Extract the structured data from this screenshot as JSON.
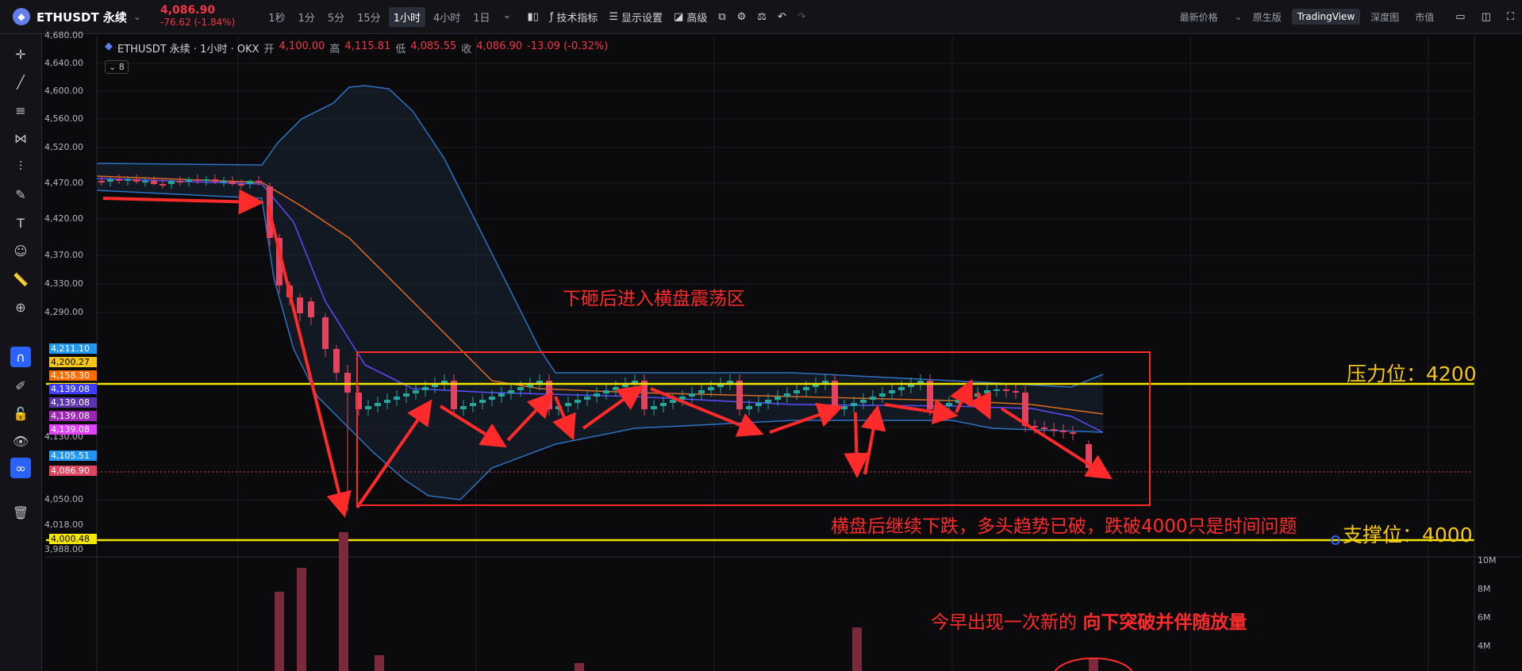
{
  "topbar": {
    "coin_icon": "eth-icon",
    "symbol": "ETHUSDT 永续",
    "last_price": "4,086.90",
    "change": "-76.62 (-1.84%)",
    "timeframes": [
      "1秒",
      "1分",
      "5分",
      "15分",
      "1小时",
      "4小时",
      "1日"
    ],
    "active_timeframe": "1小时",
    "tools": [
      "技术指标",
      "显示设置",
      "高级"
    ],
    "price_type": "最新价格",
    "views": [
      "原生版",
      "TradingView",
      "深度图",
      "市值"
    ],
    "active_view": "TradingView"
  },
  "legend": {
    "title": "ETHUSDT 永续 · 1小时 · OKX",
    "open_label": "开",
    "open": "4,100.00",
    "high_label": "高",
    "high": "4,115.81",
    "low_label": "低",
    "low": "4,085.55",
    "close_label": "收",
    "close": "4,086.90",
    "chg": "-13.09 (-0.32%)",
    "collapse": "8"
  },
  "price_axis": [
    "4,680.00",
    "4,640.00",
    "4,600.00",
    "4,560.00",
    "4,520.00",
    "4,470.00",
    "4,420.00",
    "4,370.00",
    "4,330.00",
    "4,290.00",
    "4,130.00",
    "4,050.00",
    "4,018.00",
    "3,988.00"
  ],
  "price_tags": [
    {
      "text": "4,211.10",
      "color": "#2196f3"
    },
    {
      "text": "4,200.27",
      "color": "#f5c518"
    },
    {
      "text": "4,158.30",
      "color": "#ff6d00"
    },
    {
      "text": "4,139.08",
      "color": "#3d3dff"
    },
    {
      "text": "4,139.08",
      "color": "#5e35b1"
    },
    {
      "text": "4,139.08",
      "color": "#9c27b0"
    },
    {
      "text": "4,139.08",
      "color": "#e040fb"
    },
    {
      "text": "4,105.51",
      "color": "#2196f3"
    },
    {
      "text": "4,086.90",
      "color": "#e0445f"
    },
    {
      "text": "4,000.48",
      "color": "#f5e600"
    }
  ],
  "volume_axis": [
    "10M",
    "8M",
    "6M",
    "4M"
  ],
  "annotations": {
    "range_label": "下砸后进入横盘震荡区",
    "resistance": "压力位：4200",
    "support": "支撑位：4000",
    "breakdown_note": "横盘后继续下跌，多头趋势已破，跌破4000只是时间问题",
    "volume_note_a": "今早出现一次新的",
    "volume_note_b": "向下突破并伴随放量"
  },
  "colors": {
    "up": "#26a69a",
    "down": "#e0445f",
    "annotation": "#ff2a2a",
    "level": "#f5e600"
  }
}
